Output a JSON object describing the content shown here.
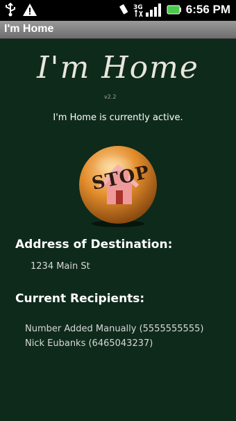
{
  "status_bar": {
    "time": "6:56 PM",
    "icons": [
      "usb-icon",
      "warning-icon",
      "vibrate-icon",
      "3g-signal-icon",
      "battery-icon"
    ]
  },
  "title_bar": {
    "title": "I'm Home"
  },
  "main": {
    "app_title": "I'm Home",
    "version": "v2.2",
    "status_message": "I'm Home is currently active.",
    "stop_label": "STOP",
    "address_heading": "Address of Destination:",
    "address_value": "1234 Main St",
    "recipients_heading": "Current Recipients:",
    "recipients": [
      "Number Added Manually (5555555555)",
      "Nick Eubanks (6465043237)"
    ]
  },
  "colors": {
    "background": "#0e2a1b",
    "button_orange": "#e08a2a",
    "house_pink": "#e98c8c"
  }
}
